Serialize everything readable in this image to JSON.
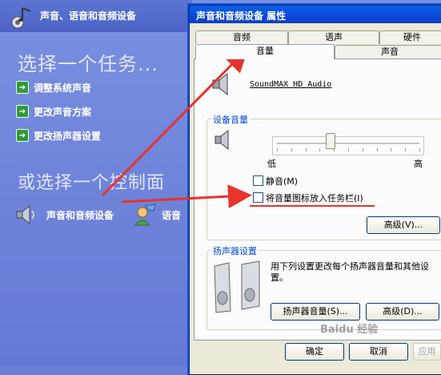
{
  "control_panel": {
    "header_title": "声音、语音和音频设备",
    "task_heading": "选择一个任务...",
    "tasks": [
      {
        "label": "调整系统声音"
      },
      {
        "label": "更改声音方案"
      },
      {
        "label": "更改扬声器设置"
      }
    ],
    "or_heading": "或选择一个控制面",
    "items": [
      {
        "label": "声音和音频设备",
        "icon": "speaker-icon"
      },
      {
        "label": "语音",
        "icon": "speech-icon"
      }
    ]
  },
  "dialog": {
    "title": "声音和音频设备 属性",
    "tabs_row1": [
      "音频",
      "语声",
      "硬件"
    ],
    "tabs_row2": [
      "音量",
      "声音"
    ],
    "active_tab": "音量",
    "device_name": "SoundMAX HD Audio",
    "device_volume_group": "设备音量",
    "slider": {
      "low_label": "低",
      "high_label": "高",
      "level": 0.37
    },
    "mute": {
      "label": "静音(M)",
      "checked": false
    },
    "taskbar_icon": {
      "label": "将音量图标放入任务栏(I)",
      "checked": false
    },
    "advanced_button": "高级(V)...",
    "speaker_group": "扬声器设置",
    "speaker_desc": "用下列设置更改每个扬声器音量和其他设置。",
    "speaker_volume_button": "扬声器音量(S)...",
    "speaker_advanced_button": "高级(D)...",
    "ok_button": "确定",
    "cancel_button": "取消",
    "apply_button": "应用(A)"
  },
  "watermark": "Baidu 经验",
  "colors": {
    "annotation": "#e8332a",
    "accent": "#0a5fe8"
  }
}
